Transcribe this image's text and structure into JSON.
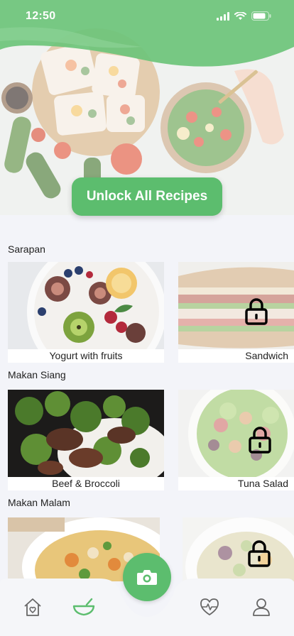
{
  "status_bar": {
    "time": "12:50"
  },
  "hero": {
    "unlock_label": "Unlock All Recipes"
  },
  "sections": [
    {
      "title": "Sarapan",
      "items": [
        {
          "name": "Yogurt with fruits",
          "locked": false
        },
        {
          "name": "Sandwich",
          "locked": true
        }
      ]
    },
    {
      "title": "Makan Siang",
      "items": [
        {
          "name": "Beef & Broccoli",
          "locked": false
        },
        {
          "name": "Tuna Salad",
          "locked": true
        }
      ]
    },
    {
      "title": "Makan Malam",
      "items": [
        {
          "name": "",
          "locked": false
        },
        {
          "name": "",
          "locked": true
        }
      ]
    }
  ],
  "nav": {
    "items": [
      "home-icon",
      "bowl-icon",
      "camera-icon",
      "heart-pulse-icon",
      "profile-icon"
    ],
    "active": "bowl-icon"
  },
  "colors": {
    "accent": "#5cbd6e",
    "background": "#f3f4f9"
  }
}
